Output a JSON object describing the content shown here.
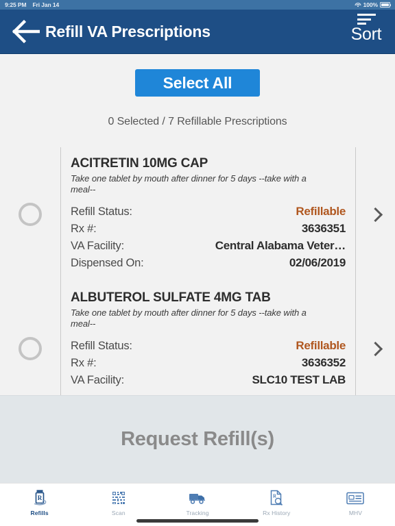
{
  "status_bar": {
    "time": "9:25 PM",
    "date": "Fri Jan 14",
    "battery_percent": "100%",
    "wifi_icon": "wifi-icon",
    "battery_icon": "battery-icon"
  },
  "header": {
    "title": "Refill VA Prescriptions",
    "back_icon": "back-arrow-icon",
    "sort_label": "Sort",
    "sort_icon": "sort-lines-icon",
    "background_color": "#1e4e85"
  },
  "toolbar": {
    "select_all_label": "Select All",
    "select_all_color": "#1f86d8",
    "count_text": "0 Selected / 7 Refillable Prescriptions",
    "selected_count": 0,
    "refillable_count": 7
  },
  "labels": {
    "refill_status": "Refill Status:",
    "rx_number": "Rx #:",
    "va_facility": "VA Facility:",
    "dispensed_on": "Dispensed On:"
  },
  "prescriptions": [
    {
      "name": "ACITRETIN 10MG CAP",
      "sig": "Take one tablet by mouth after dinner for 5 days --take with a meal--",
      "refill_status": "Refillable",
      "rx_number": "3636351",
      "va_facility": "Central Alabama Veter…",
      "dispensed_on": "02/06/2019",
      "selected": false,
      "status_color": "#b0571f"
    },
    {
      "name": "ALBUTEROL SULFATE 4MG TAB",
      "sig": "Take one tablet by mouth after dinner for 5 days --take with a meal--",
      "refill_status": "Refillable",
      "rx_number": "3636352",
      "va_facility": "SLC10 TEST LAB",
      "dispensed_on": "",
      "selected": false,
      "status_color": "#b0571f"
    }
  ],
  "action_bar": {
    "label": "Request Refill(s)",
    "enabled": false
  },
  "tabs": [
    {
      "label": "Refills",
      "icon": "pill-bottle-rx-icon",
      "active": true
    },
    {
      "label": "Scan",
      "icon": "qr-code-scan-icon",
      "active": false
    },
    {
      "label": "Tracking",
      "icon": "delivery-truck-icon",
      "active": false
    },
    {
      "label": "Rx History",
      "icon": "document-magnifier-icon",
      "active": false
    },
    {
      "label": "MHV",
      "icon": "id-card-icon",
      "active": false
    }
  ]
}
